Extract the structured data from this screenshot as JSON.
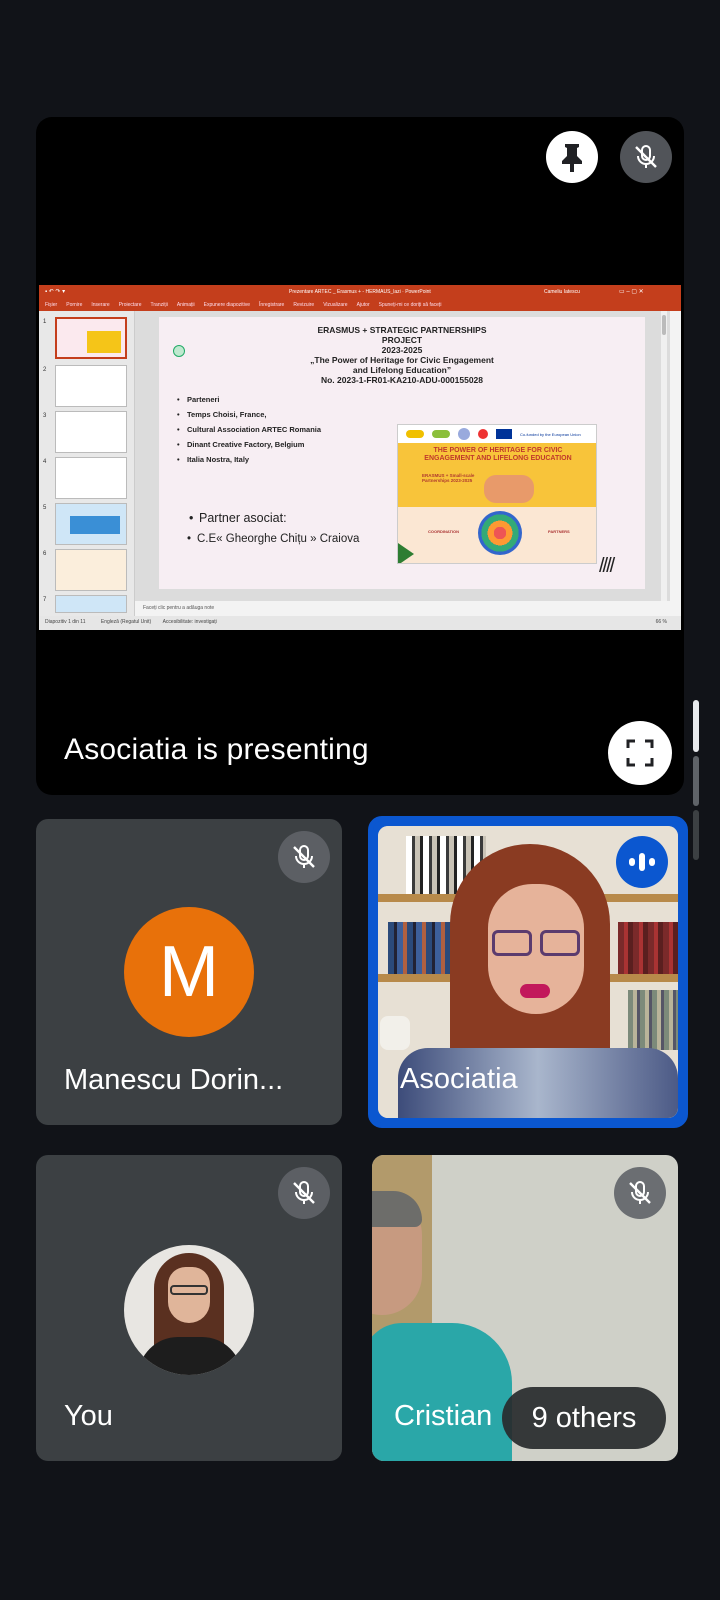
{
  "presentation": {
    "presenting_label": "Asociatia is presenting",
    "pin_icon": "pin-icon",
    "mic_off_icon": "mic-off-icon",
    "fullscreen_icon": "fullscreen-icon"
  },
  "ppt": {
    "title_bar": "Prezentare ARTEC _ Erasmus + - HERMAUS_lazi  ·  PowerPoint",
    "user": "Cameliu Iatescu",
    "ribbon_tabs": [
      "Fișier",
      "Pornire",
      "Inserare",
      "Proiectare",
      "Tranziții",
      "Animații",
      "Expunere diapozitive",
      "Înregistrare",
      "Revizuire",
      "Vizualizare",
      "Ajutor",
      "Spuneți-mi ce doriți să faceți"
    ],
    "thumb_numbers": [
      "1",
      "2",
      "3",
      "4",
      "5",
      "6",
      "7"
    ],
    "slide": {
      "title_line1": "ERASMUS + STRATEGIC PARTNERSHIPS",
      "title_line2": "PROJECT",
      "title_line3": "2023-2025",
      "title_line4": "„The Power of Heritage for Civic Engagement",
      "title_line5": "and Lifelong Education”",
      "title_line6": "No. 2023-1-FR01-KA210-ADU-000155028",
      "bullets": [
        "Parteneri",
        "Temps Choisi, France,",
        "Cultural Association ARTEC Romania",
        "Dinant Creative Factory, Belgium",
        "Italia Nostra, Italy"
      ],
      "associate_bullets": [
        "Partner asociat:",
        "C.E« Gheorghe Chițu »  Craiova"
      ],
      "poster_title": "THE POWER OF HERITAGE FOR CIVIC ENGAGEMENT AND LIFELONG EDUCATION",
      "poster_sub": "ERASMUS + Small-scale Partnerships 2023-2025",
      "poster_coord": "COORDINATION",
      "poster_partners": "PARTNERS",
      "eu_logo_text": "Co-funded by the European Union"
    },
    "notes_placeholder": "Faceți clic pentru a adăuga note",
    "status_left": "Diapozitiv 1 din 11",
    "status_lang": "Engleză (Regatul Unit)",
    "status_access": "Accesibilitate: investigați",
    "status_zoom": "66 %"
  },
  "participants": {
    "manescu": {
      "name": "Manescu Dorin...",
      "initial": "M",
      "avatar_color": "#e8710a"
    },
    "asociatia": {
      "name": "Asociatia",
      "speaking_icon": "speaking-indicator-icon"
    },
    "you": {
      "name": "You"
    },
    "cristian": {
      "name": "Cristian"
    },
    "others": {
      "label": "9 others"
    }
  },
  "colors": {
    "background": "#111318",
    "tile": "#3c4043",
    "active_speaker_border": "#0b57d0",
    "ppt_accent": "#c43e1c"
  }
}
